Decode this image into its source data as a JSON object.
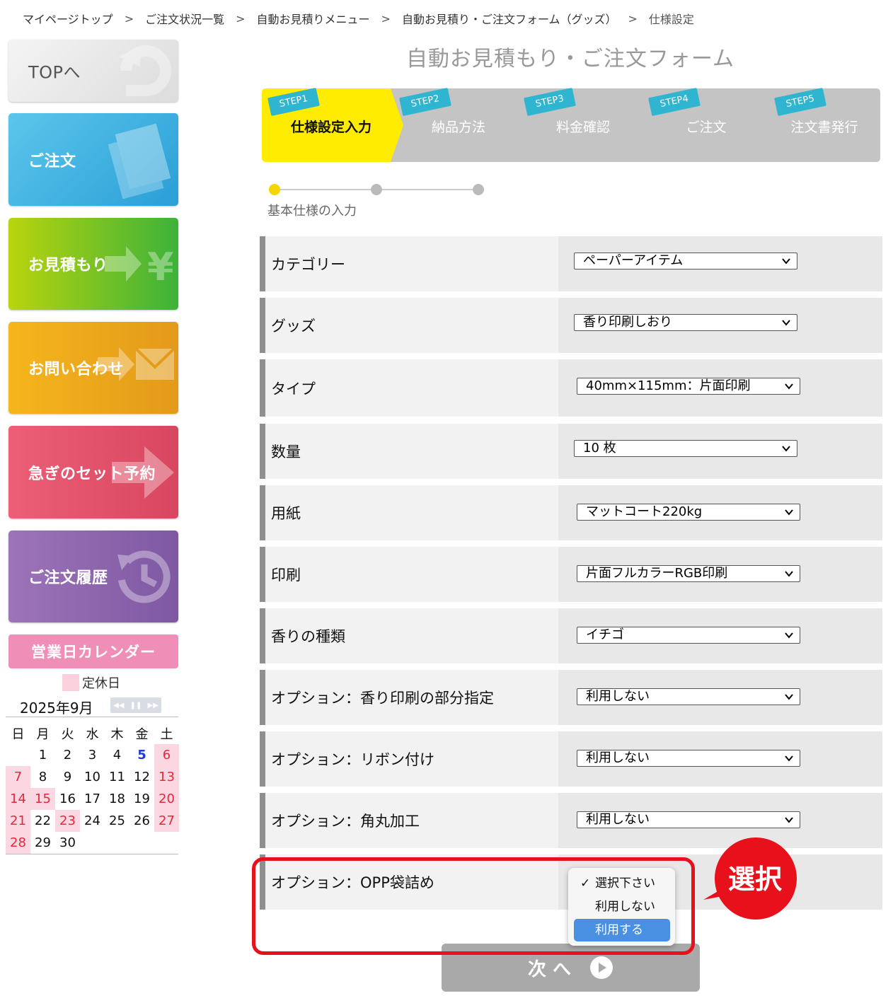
{
  "breadcrumb": {
    "items": [
      "マイページトップ",
      "ご注文状況一覧",
      "自動お見積りメニュー",
      "自動お見積り・ご注文フォーム（グッズ）",
      "仕様設定"
    ],
    "separator": ">"
  },
  "sidebar": {
    "top": "TOPへ",
    "order": "ご注文",
    "estimate": "お見積もり",
    "contact": "お問い合わせ",
    "rush": "急ぎのセット予約",
    "history": "ご注文履歴"
  },
  "calendar": {
    "header": "営業日カレンダー",
    "legend": "定休日",
    "month": "2025年9月",
    "weekdays": [
      "日",
      "月",
      "火",
      "水",
      "木",
      "金",
      "土"
    ],
    "weeks": [
      [
        "",
        "1",
        "2",
        "3",
        "4",
        "5",
        "6"
      ],
      [
        "7",
        "8",
        "9",
        "10",
        "11",
        "12",
        "13"
      ],
      [
        "14",
        "15",
        "16",
        "17",
        "18",
        "19",
        "20"
      ],
      [
        "21",
        "22",
        "23",
        "24",
        "25",
        "26",
        "27"
      ],
      [
        "28",
        "29",
        "30",
        "",
        "",
        "",
        ""
      ]
    ],
    "holidays": [
      "6",
      "7",
      "13",
      "14",
      "15",
      "20",
      "21",
      "23",
      "27",
      "28"
    ],
    "highlighted_blue": [
      "5"
    ]
  },
  "main": {
    "title": "自動お見積もり・ご注文フォーム",
    "steps": [
      {
        "badge": "STEP1",
        "label": "仕様設定入力",
        "active": true
      },
      {
        "badge": "STEP2",
        "label": "納品方法",
        "active": false
      },
      {
        "badge": "STEP3",
        "label": "料金確認",
        "active": false
      },
      {
        "badge": "STEP4",
        "label": "ご注文",
        "active": false
      },
      {
        "badge": "STEP5",
        "label": "注文書発行",
        "active": false
      }
    ],
    "progress_label": "基本仕様の入力",
    "rows": [
      {
        "label": "カテゴリー",
        "value": "ペーパーアイテム"
      },
      {
        "label": "グッズ",
        "value": "香り印刷しおり"
      },
      {
        "label": "タイプ",
        "value": "40mm×115mm：片面印刷"
      },
      {
        "label": "数量",
        "value": "10 枚"
      },
      {
        "label": "用紙",
        "value": "マットコート220kg"
      },
      {
        "label": "印刷",
        "value": "片面フルカラーRGB印刷"
      },
      {
        "label": "香りの種類",
        "value": "イチゴ"
      },
      {
        "label": "オプション：香り印刷の部分指定",
        "value": "利用しない"
      },
      {
        "label": "オプション：リボン付け",
        "value": "利用しない"
      },
      {
        "label": "オプション：角丸加工",
        "value": "利用しない"
      },
      {
        "label": "オプション：OPP袋詰め",
        "value": "選択下さい"
      }
    ],
    "dropdown_options": [
      {
        "label": "選択下さい",
        "checked": true
      },
      {
        "label": "利用しない",
        "checked": false
      },
      {
        "label": "利用する",
        "checked": false,
        "highlighted": true
      }
    ],
    "callout": "選択",
    "next_button": "次 へ"
  },
  "colors": {
    "active_step": "#ffec00",
    "inactive_step": "#c4c4c4",
    "highlight": "#4a90e2",
    "annotation_red": "#e8101a"
  }
}
